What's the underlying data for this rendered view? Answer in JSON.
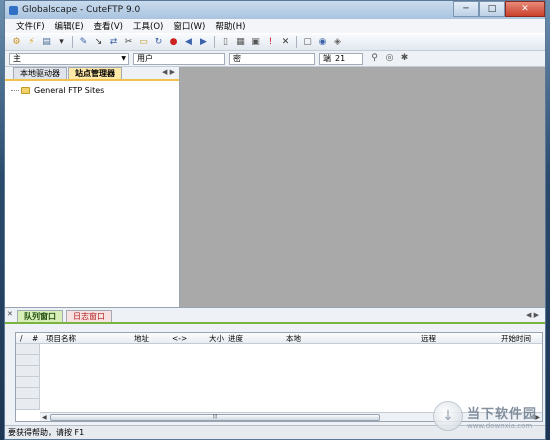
{
  "window": {
    "title": "Globalscape - CuteFTP 9.0",
    "min_label": "─",
    "max_label": "□",
    "close_label": "✕"
  },
  "menu": [
    "文件(F)",
    "编辑(E)",
    "查看(V)",
    "工具(O)",
    "窗口(W)",
    "帮助(H)"
  ],
  "toolbar_icons": [
    {
      "name": "connect-wizard-icon",
      "glyph": "⚙",
      "color": "#d08b1b"
    },
    {
      "name": "quick-connect-icon",
      "glyph": "⚡",
      "color": "#d8a21c"
    },
    {
      "name": "new-site-icon",
      "glyph": "▤",
      "color": "#4a6e94"
    },
    {
      "name": "dropdown-arrow-icon",
      "glyph": "▾",
      "color": "#333"
    },
    {
      "name": "edit-icon",
      "glyph": "✎",
      "color": "#3a62a8"
    },
    {
      "name": "select-icon",
      "glyph": "↘",
      "color": "#333"
    },
    {
      "name": "transfer-icon",
      "glyph": "⇄",
      "color": "#3a62a8"
    },
    {
      "name": "scissors-icon",
      "glyph": "✂",
      "color": "#444"
    },
    {
      "name": "folder-icon",
      "glyph": "▭",
      "color": "#c09a2a"
    },
    {
      "name": "refresh-icon",
      "glyph": "↻",
      "color": "#3a62a8"
    },
    {
      "name": "stop-icon",
      "glyph": "●",
      "color": "#cc2222"
    },
    {
      "name": "back-icon",
      "glyph": "◀",
      "color": "#3a62a8"
    },
    {
      "name": "forward-icon",
      "glyph": "▶",
      "color": "#3a62a8"
    },
    {
      "name": "new-file-icon",
      "glyph": "▯",
      "color": "#666"
    },
    {
      "name": "view-icon",
      "glyph": "▦",
      "color": "#555"
    },
    {
      "name": "properties-icon",
      "glyph": "▣",
      "color": "#555"
    },
    {
      "name": "exclamation-icon",
      "glyph": "!",
      "color": "#d02020"
    },
    {
      "name": "delete-icon",
      "glyph": "✕",
      "color": "#333"
    },
    {
      "name": "rename-icon",
      "glyph": "▢",
      "color": "#555"
    },
    {
      "name": "globe-icon",
      "glyph": "◉",
      "color": "#3a62a8"
    },
    {
      "name": "shield-icon",
      "glyph": "◈",
      "color": "#666"
    }
  ],
  "address": {
    "host_label": "主",
    "user_label": "用户",
    "password_label": "密",
    "port_label": "端",
    "port_value": "21"
  },
  "address_icons": [
    {
      "name": "connect-icon",
      "glyph": "⚲",
      "color": "#555"
    },
    {
      "name": "disconnect-icon",
      "glyph": "◎",
      "color": "#555"
    },
    {
      "name": "settings-icon",
      "glyph": "✱",
      "color": "#555"
    }
  ],
  "left_pane": {
    "tabs": [
      "本地驱动器",
      "站点管理器"
    ],
    "active_tab_index": 1,
    "nav_prev": "◀",
    "nav_next": "▶",
    "tree_root": "General FTP Sites"
  },
  "bottom_pane": {
    "close_glyph": "✕",
    "tabs": [
      "队列窗口",
      "日志窗口"
    ],
    "active_tab_index": 0,
    "nav_prev": "◀",
    "nav_next": "▶",
    "columns": [
      "/",
      "#",
      "项目名称",
      "地址",
      "<->",
      "大小",
      "进度",
      "本地",
      "远程",
      "开始时间"
    ],
    "scroll_grip": "⦙⦙⦙",
    "scroll_left": "◀",
    "scroll_right": "▶"
  },
  "status": {
    "text": "要获得帮助，请按 F1"
  },
  "watermark": {
    "logo_glyph": "↓",
    "cn_text": "当下软件园",
    "url_text": "www.downxia.com"
  }
}
